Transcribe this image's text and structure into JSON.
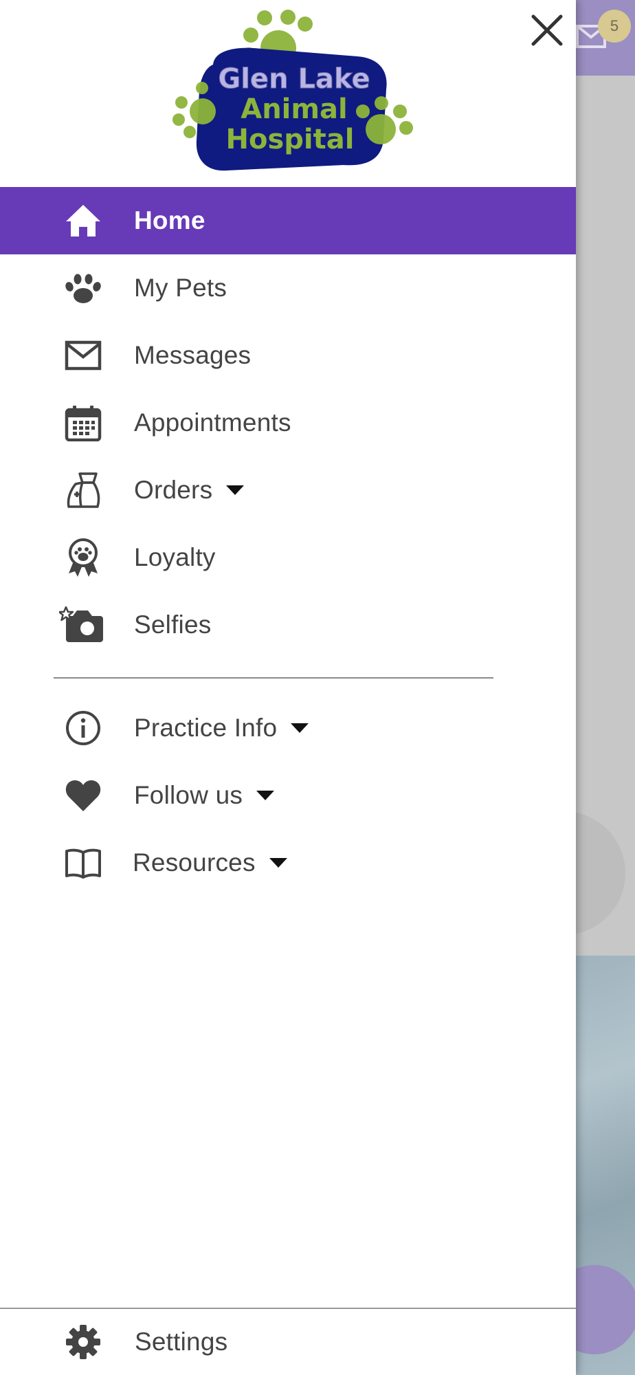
{
  "background": {
    "unread_count": "5"
  },
  "drawer": {
    "logo": {
      "line1": "Glen Lake",
      "line2": "Animal",
      "line3": "Hospital"
    },
    "menu": [
      {
        "label": "Home",
        "icon": "home-icon",
        "active": true
      },
      {
        "label": "My Pets",
        "icon": "paw-icon"
      },
      {
        "label": "Messages",
        "icon": "envelope-icon"
      },
      {
        "label": "Appointments",
        "icon": "calendar-icon"
      },
      {
        "label": "Orders",
        "icon": "pet-food-bag-icon",
        "dropdown": true
      },
      {
        "label": "Loyalty",
        "icon": "paw-ribbon-icon"
      },
      {
        "label": "Selfies",
        "icon": "camera-star-icon"
      }
    ],
    "secondary_menu": [
      {
        "label": "Practice Info",
        "icon": "info-icon",
        "dropdown": true
      },
      {
        "label": "Follow us",
        "icon": "heart-icon",
        "dropdown": true
      },
      {
        "label": "Resources",
        "icon": "book-icon",
        "dropdown": true
      }
    ],
    "settings": {
      "label": "Settings",
      "icon": "gear-icon"
    }
  },
  "colors": {
    "accent": "#673ab7",
    "logo_navy": "#0f1b80",
    "logo_green": "#8db43a",
    "icon_gray": "#444444"
  }
}
